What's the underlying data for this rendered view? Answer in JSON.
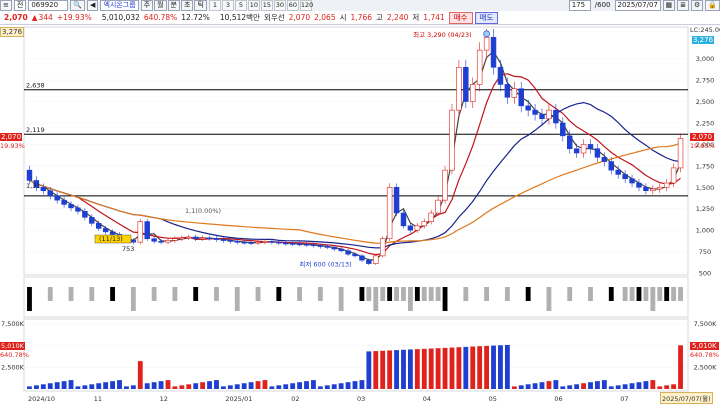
{
  "toolbar": {
    "code": "069920",
    "name_prefix": "전",
    "company": "엑시온그룹",
    "period_tabs": [
      "주",
      "월",
      "분",
      "초",
      "틱"
    ],
    "minute_numbers": [
      "1",
      "3",
      "5",
      "10",
      "15",
      "30",
      "60",
      "120"
    ],
    "count": "175",
    "count_total": "/600",
    "date": "2025/07/07"
  },
  "info": {
    "price": "2,070",
    "change_arrow": "▲",
    "change": "344",
    "change_pct": "+19.93%",
    "volume": "5,010,032",
    "volume_ratio": "640.78%",
    "turnover": "12.72%",
    "amount": "10,512백만",
    "prefix_label": "외우선",
    "open_val": "2,070",
    "open_val2": "2,065",
    "high_label": "시",
    "high_val": "1,766",
    "low_label": "고",
    "low_val": "2,240",
    "close_label": "저",
    "close_val": "1,741",
    "buy_label": "매수",
    "sell_label": "매도"
  },
  "chart": {
    "left_top_label": "3,276",
    "right_top_label": "LC:245.00",
    "right_top_sub": "3,276",
    "price_axis": [
      "3,000",
      "2,750",
      "2,500",
      "2,250",
      "2,000",
      "1,750",
      "1,500",
      "1,250",
      "1,000",
      "750",
      "500"
    ],
    "hlines": [
      "2,638",
      "2,119"
    ],
    "high_annot": "최고 3,290 (04/23)",
    "low_annot": "최저 600 (03/13)",
    "mid_annot_1": "1,1(0.00%)",
    "mid_annot_2": "(11/13)",
    "mid_annot_3": "753",
    "left_axis_label": "1,31",
    "current_price_tag": "2,070",
    "current_pct_tag": "19.93%",
    "volume_axis": [
      "7,500K",
      "5,000K",
      "2,500K"
    ],
    "volume_tag": "5,010K",
    "volume_pct_tag": "640.78%",
    "x_axis": [
      "2024/10",
      "11",
      "12",
      "2025/01",
      "02",
      "03",
      "04",
      "05",
      "06",
      "07"
    ],
    "last_date_tag": "2025/07/07(월)",
    "colors": {
      "up": "#e0221c",
      "down": "#1f3fd1",
      "ma5": "#444444",
      "ma20": "#c0141b",
      "ma60": "#17248c",
      "ma120": "#e07a1e"
    }
  },
  "chart_data": {
    "type": "candlestick",
    "title": "",
    "ylim": [
      500,
      3300
    ],
    "series": [
      {
        "name": "",
        "values": [
          [
            1700,
            1580
          ],
          [
            1580,
            1500
          ],
          [
            1500,
            1460
          ],
          [
            1460,
            1400
          ],
          [
            1400,
            1350
          ],
          [
            1350,
            1300
          ],
          [
            1300,
            1260
          ],
          [
            1260,
            1220
          ],
          [
            1220,
            1150
          ],
          [
            1150,
            1080
          ],
          [
            1080,
            1020
          ],
          [
            1020,
            980
          ],
          [
            980,
            950
          ],
          [
            950,
            900
          ],
          [
            900,
            880
          ],
          [
            880,
            860
          ],
          [
            860,
            1100
          ],
          [
            1100,
            900
          ],
          [
            900,
            870
          ],
          [
            870,
            860
          ],
          [
            860,
            880
          ],
          [
            880,
            900
          ],
          [
            900,
            910
          ],
          [
            910,
            920
          ],
          [
            920,
            900
          ],
          [
            900,
            910
          ],
          [
            910,
            905
          ],
          [
            905,
            890
          ],
          [
            890,
            880
          ],
          [
            880,
            870
          ],
          [
            870,
            860
          ],
          [
            860,
            855
          ],
          [
            855,
            850
          ],
          [
            850,
            860
          ],
          [
            860,
            870
          ],
          [
            870,
            860
          ],
          [
            860,
            850
          ],
          [
            850,
            845
          ],
          [
            845,
            840
          ],
          [
            840,
            835
          ],
          [
            835,
            830
          ],
          [
            830,
            820
          ],
          [
            820,
            810
          ],
          [
            810,
            800
          ],
          [
            800,
            780
          ],
          [
            780,
            760
          ],
          [
            760,
            720
          ],
          [
            720,
            700
          ],
          [
            700,
            650
          ],
          [
            650,
            610
          ],
          [
            610,
            700
          ],
          [
            700,
            900
          ],
          [
            900,
            1500
          ],
          [
            1500,
            1200
          ],
          [
            1200,
            1050
          ],
          [
            1050,
            1000
          ],
          [
            1000,
            1050
          ],
          [
            1050,
            1100
          ],
          [
            1100,
            1200
          ],
          [
            1200,
            1350
          ],
          [
            1350,
            1700
          ],
          [
            1700,
            2400
          ],
          [
            2400,
            2900
          ],
          [
            2900,
            2500
          ],
          [
            2500,
            2700
          ],
          [
            2700,
            3100
          ],
          [
            3100,
            3250
          ],
          [
            3250,
            2900
          ],
          [
            2900,
            2700
          ],
          [
            2700,
            2550
          ],
          [
            2550,
            2650
          ],
          [
            2650,
            2450
          ],
          [
            2450,
            2400
          ],
          [
            2400,
            2350
          ],
          [
            2350,
            2300
          ],
          [
            2300,
            2400
          ],
          [
            2400,
            2250
          ],
          [
            2250,
            2100
          ],
          [
            2100,
            1950
          ],
          [
            1950,
            1900
          ],
          [
            1900,
            2000
          ],
          [
            2000,
            1950
          ],
          [
            1950,
            1850
          ],
          [
            1850,
            1800
          ],
          [
            1800,
            1700
          ],
          [
            1700,
            1650
          ],
          [
            1650,
            1600
          ],
          [
            1600,
            1550
          ],
          [
            1550,
            1500
          ],
          [
            1500,
            1460
          ],
          [
            1460,
            1480
          ],
          [
            1480,
            1500
          ],
          [
            1500,
            1550
          ],
          [
            1550,
            1726
          ],
          [
            1726,
            2070
          ]
        ]
      }
    ]
  }
}
